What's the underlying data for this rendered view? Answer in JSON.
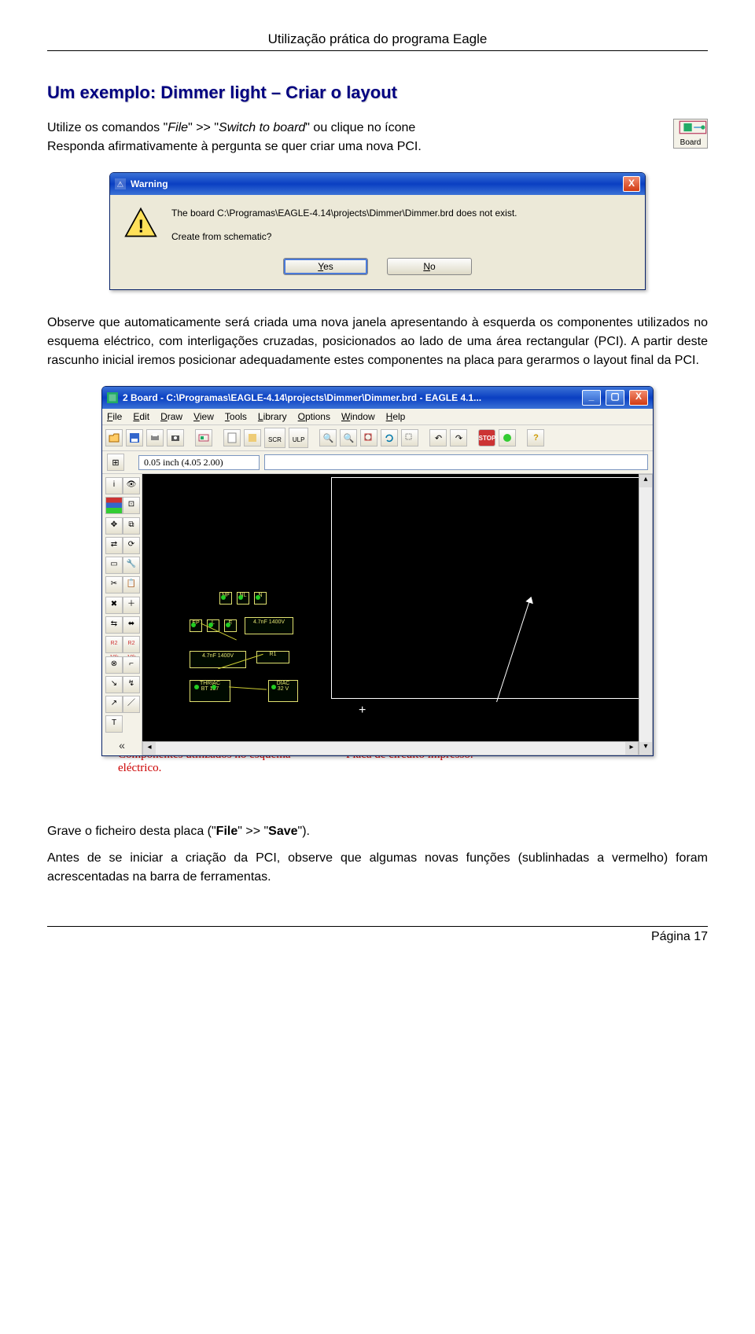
{
  "docHeader": "Utilização prática do programa Eagle",
  "title": "Um exemplo: Dimmer light – Criar o layout",
  "para1a": "Utilize os comandos \"",
  "para1_file": "File",
  "para1b": "\" >> \"",
  "para1_switch": "Switch to board",
  "para1c": "\" ou clique no ícone",
  "para1d": "Responda afirmativamente à pergunta se quer criar uma nova PCI.",
  "boardIconLabel": "Board",
  "dialog": {
    "title": "Warning",
    "msg1": "The board C:\\Programas\\EAGLE-4.14\\projects\\Dimmer\\Dimmer.brd does not exist.",
    "msg2": "Create from schematic?",
    "yes": "Yes",
    "no": "No",
    "close": "X"
  },
  "para2": "Observe que automaticamente será criada uma nova janela apresentando à esquerda os componentes utilizados no esquema eléctrico, com interligações cruzadas, posicionados ao lado de uma área rectangular (PCI). A partir deste rascunho inicial iremos posicionar adequadamente estes componentes na placa para gerarmos o layout final da PCI.",
  "eagle": {
    "title": "2 Board - C:\\Programas\\EAGLE-4.14\\projects\\Dimmer\\Dimmer.brd - EAGLE 4.1...",
    "menus": {
      "file": "File",
      "edit": "Edit",
      "draw": "Draw",
      "view": "View",
      "tools": "Tools",
      "library": "Library",
      "options": "Options",
      "window": "Window",
      "help": "Help"
    },
    "scrBtn": "SCR",
    "ulpBtn": "ULP",
    "stopBtn": "STOP",
    "coord": "0.05 inch (4.05 2.00)",
    "parts": {
      "np": "NP",
      "nl": "NL",
      "n": "N",
      "ep": "EP",
      "l": "L",
      "e": "E",
      "c2": "4.7nF 1400V",
      "c1": "4.7nF 1400V",
      "r1": "R1",
      "thriac": "THRIAC",
      "thval": "BT 137",
      "diac": "DIAC",
      "diacv": "32 V"
    }
  },
  "captions": {
    "c1": "Componentes utilizados no esquema eléctrico.",
    "c2": "Placa de circuito impresso."
  },
  "para3a": "Grave o ficheiro desta placa (\"",
  "para3_file": "File",
  "para3b": "\" >> \"",
  "para3_save": "Save",
  "para3c": "\").",
  "para4": "Antes de se iniciar a criação da PCI, observe que algumas novas funções (sublinhadas a vermelho) foram acrescentadas na barra de ferramentas.",
  "footer": "Página 17"
}
